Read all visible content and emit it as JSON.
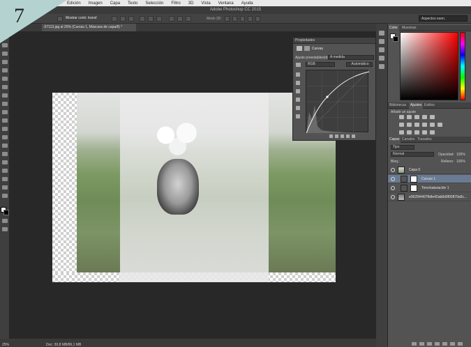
{
  "step_number": "7",
  "menubar": {
    "items": [
      "Edición",
      "Imagen",
      "Capa",
      "Texto",
      "Selección",
      "Filtro",
      "3D",
      "Vista",
      "Ventana",
      "Ayuda"
    ]
  },
  "app_title": "Adobe Photoshop CC 2015",
  "options_bar": {
    "show_transform_label": "Mostrar contr. transf.",
    "mode_3d_label": "Modo 3D:",
    "workspace": "Aspectos esen."
  },
  "document_tab": "-57113.jpg al 25% (Curvas 1, Máscara de capa/8) *",
  "status_bar": {
    "zoom": "25%",
    "doc_size": "Doc: 30,8 MB/86,1 MB"
  },
  "properties_panel": {
    "title": "Propiedades",
    "subtitle": "Curvas",
    "preset_label": "Ajuste preestablecido:",
    "preset_value": "A medida",
    "channel": "RGB",
    "auto_button": "Automático"
  },
  "color_panel": {
    "tabs": [
      "Color",
      "Muestras"
    ],
    "foreground": "#ffffff",
    "background": "#000000"
  },
  "adjustments_panel": {
    "tabs": [
      "Bibliotecas",
      "Ajustes",
      "Estilos"
    ],
    "add_label": "Añadir un ajuste"
  },
  "layers_panel": {
    "tabs": [
      "Capas",
      "Canales",
      "Trazados"
    ],
    "filter_label": "Tipo",
    "blend_mode": "Normal",
    "opacity_label": "Opacidad:",
    "opacity_value": "100%",
    "lock_label": "Bloq.:",
    "fill_label": "Relleno:",
    "fill_value": "100%",
    "layers": [
      {
        "name": "Capa 0",
        "selected": false
      },
      {
        "name": "Curvas 1",
        "selected": true
      },
      {
        "name": "Tono/saturación 1",
        "selected": false
      },
      {
        "name": "e0625f4407fb8e42ab8d9f00879a9c...",
        "selected": false
      }
    ]
  }
}
